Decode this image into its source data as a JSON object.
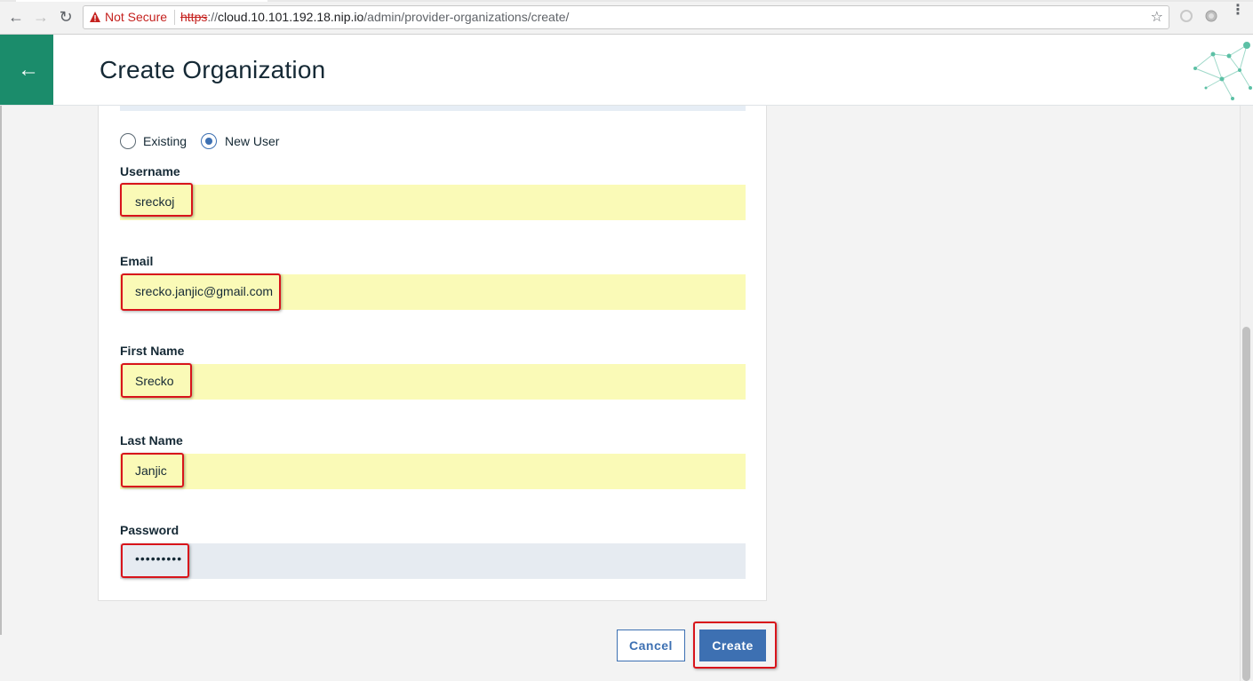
{
  "browser": {
    "security_label": "Not Secure",
    "url_scheme": "https",
    "url_sep": "://",
    "url_host": "cloud.10.101.192.18.nip.io",
    "url_path": "/admin/provider-organizations/create/",
    "warning_color": "#c5221f"
  },
  "header": {
    "title": "Create Organization",
    "accent_color": "#1b8c6b",
    "back_icon": "arrow-left-icon"
  },
  "form": {
    "owner_options": [
      {
        "label": "Existing",
        "selected": false
      },
      {
        "label": "New User",
        "selected": true
      }
    ],
    "fields": {
      "username": {
        "label": "Username",
        "value": "sreckoj"
      },
      "email": {
        "label": "Email",
        "value": "srecko.janjic@gmail.com"
      },
      "first_name": {
        "label": "First Name",
        "value": "Srecko"
      },
      "last_name": {
        "label": "Last Name",
        "value": "Janjic"
      },
      "password": {
        "label": "Password",
        "value": "•••••••••"
      }
    },
    "autofill_color": "#fafab7"
  },
  "actions": {
    "cancel_label": "Cancel",
    "create_label": "Create",
    "primary_color": "#3d70b2",
    "highlight_color": "#d8141b"
  }
}
